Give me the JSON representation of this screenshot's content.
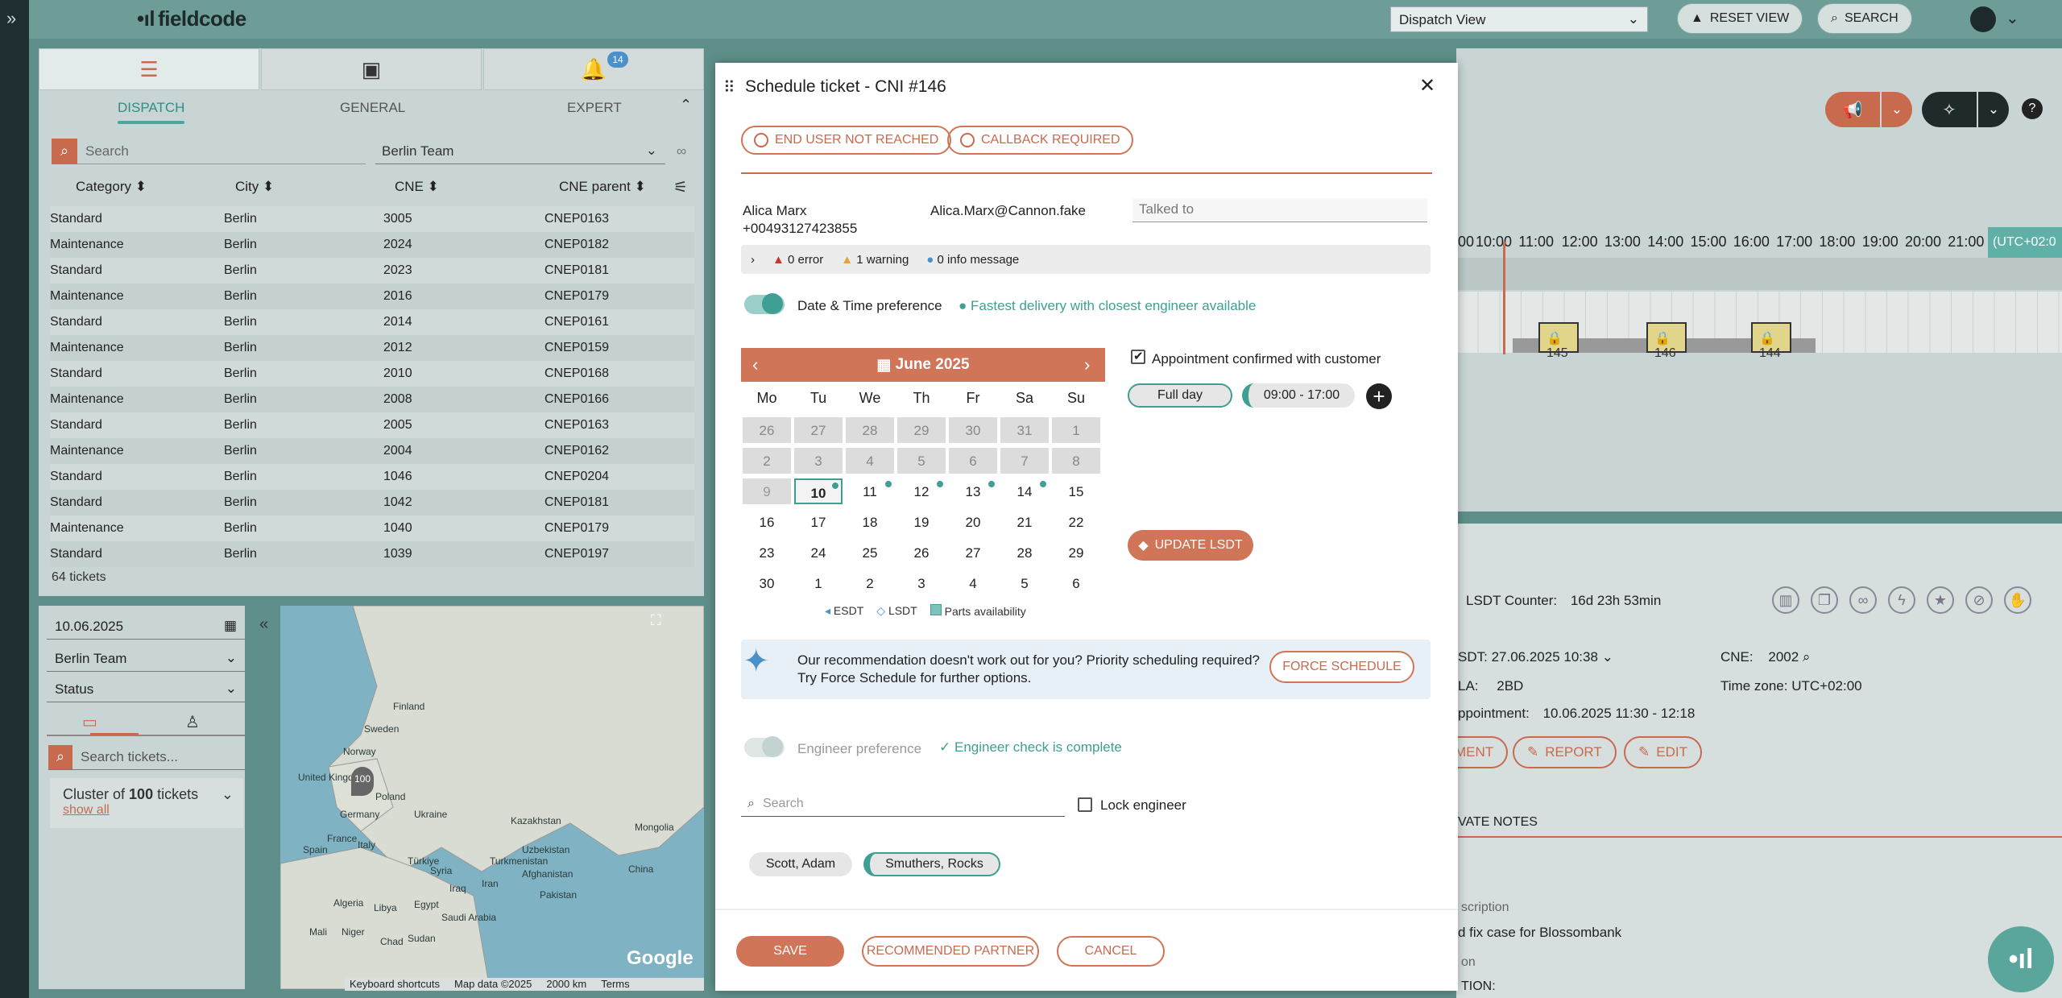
{
  "app": {
    "logo": "fieldcode",
    "view_select": "Dispatch View",
    "reset_view": "RESET VIEW",
    "search": "SEARCH",
    "expand": "»"
  },
  "left": {
    "tabs": [
      {
        "icon": "list-icon"
      },
      {
        "icon": "clipboard-icon"
      },
      {
        "icon": "bell-icon",
        "badge": "14"
      }
    ],
    "subtabs": [
      "DISPATCH",
      "GENERAL",
      "EXPERT"
    ],
    "search_placeholder": "Search",
    "team": "Berlin Team",
    "columns": [
      "Category",
      "City",
      "CNE",
      "CNE parent"
    ],
    "rows": [
      [
        "Standard",
        "Berlin",
        "3005",
        "CNEP0163"
      ],
      [
        "Maintenance",
        "Berlin",
        "2024",
        "CNEP0182"
      ],
      [
        "Standard",
        "Berlin",
        "2023",
        "CNEP0181"
      ],
      [
        "Maintenance",
        "Berlin",
        "2016",
        "CNEP0179"
      ],
      [
        "Standard",
        "Berlin",
        "2014",
        "CNEP0161"
      ],
      [
        "Maintenance",
        "Berlin",
        "2012",
        "CNEP0159"
      ],
      [
        "Standard",
        "Berlin",
        "2010",
        "CNEP0168"
      ],
      [
        "Maintenance",
        "Berlin",
        "2008",
        "CNEP0166"
      ],
      [
        "Standard",
        "Berlin",
        "2005",
        "CNEP0163"
      ],
      [
        "Maintenance",
        "Berlin",
        "2004",
        "CNEP0162"
      ],
      [
        "Standard",
        "Berlin",
        "1046",
        "CNEP0204"
      ],
      [
        "Standard",
        "Berlin",
        "1042",
        "CNEP0181"
      ],
      [
        "Maintenance",
        "Berlin",
        "1040",
        "CNEP0179"
      ],
      [
        "Standard",
        "Berlin",
        "1039",
        "CNEP0197"
      ]
    ],
    "ticket_count": "64 tickets"
  },
  "filter": {
    "date": "10.06.2025",
    "team": "Berlin Team",
    "status": "Status",
    "search_placeholder": "Search tickets...",
    "cluster_prefix": "Cluster of",
    "cluster_count": "100",
    "cluster_suffix": "tickets",
    "show_all": "show all",
    "collapse": "«"
  },
  "map": {
    "labels": [
      "Finland",
      "Sweden",
      "Norway",
      "United Kingdom",
      "Germany",
      "Poland",
      "France",
      "Spain",
      "Italy",
      "Ukraine",
      "Kazakhstan",
      "Mongolia",
      "Türkiye",
      "Uzbekistan",
      "Turkmenistan",
      "Afghanistan",
      "Iran",
      "Iraq",
      "Syria",
      "Pakistan",
      "Algeria",
      "Libya",
      "Egypt",
      "Saudi Arabia",
      "Mali",
      "Niger",
      "Chad",
      "Sudan",
      "China"
    ],
    "marker": "100",
    "footer": [
      "Keyboard shortcuts",
      "Map data ©2025",
      "2000 km",
      "Terms"
    ],
    "brand": "Google"
  },
  "timeline": {
    "hours": [
      "00",
      "10:00",
      "11:00",
      "12:00",
      "13:00",
      "14:00",
      "15:00",
      "16:00",
      "17:00",
      "18:00",
      "19:00",
      "20:00",
      "21:00"
    ],
    "tz": "(UTC+02:0",
    "tickets": [
      "145",
      "146",
      "144"
    ]
  },
  "detail": {
    "lsdt_counter_label": "LSDT Counter:",
    "lsdt_counter": "16d 23h 53min",
    "sdt_label": "SDT:",
    "sdt": "27.06.2025 10:38",
    "cne_label": "CNE:",
    "cne": "2002",
    "sla_label": "LA:",
    "sla": "2BD",
    "tz_label": "Time zone:",
    "tz": "UTC+02:00",
    "appt_label": "ppointment:",
    "appt": "10.06.2025 11:30 - 12:18",
    "btn_ment": "MENT",
    "btn_report": "REPORT",
    "btn_edit": "EDIT",
    "tab_notes": "VATE NOTES",
    "desc_label": "scription",
    "desc": "d fix case for Blossombank",
    "n_label": "on",
    "tion_label": "TION:"
  },
  "modal": {
    "title": "Schedule ticket - CNI #146",
    "status_pills": [
      "END USER NOT REACHED",
      "CALLBACK REQUIRED"
    ],
    "contact_name": "Alica Marx",
    "contact_phone": "+00493127423855",
    "contact_email": "Alica.Marx@Cannon.fake",
    "talked_placeholder": "Talked to",
    "messages": {
      "error": "0 error",
      "warning": "1 warning",
      "info": "0 info message"
    },
    "dt_pref": "Date & Time preference",
    "dt_hint": "Fastest delivery with closest engineer available",
    "calendar": {
      "month": "June 2025",
      "weekdays": [
        "Mo",
        "Tu",
        "We",
        "Th",
        "Fr",
        "Sa",
        "Su"
      ],
      "weeks": [
        [
          "26",
          "27",
          "28",
          "29",
          "30",
          "31",
          "1"
        ],
        [
          "2",
          "3",
          "4",
          "5",
          "6",
          "7",
          "8"
        ],
        [
          "9",
          "10",
          "11",
          "12",
          "13",
          "14",
          "15"
        ],
        [
          "16",
          "17",
          "18",
          "19",
          "20",
          "21",
          "22"
        ],
        [
          "23",
          "24",
          "25",
          "26",
          "27",
          "28",
          "29"
        ],
        [
          "30",
          "1",
          "2",
          "3",
          "4",
          "5",
          "6"
        ]
      ],
      "legend": [
        "ESDT",
        "LSDT",
        "Parts availability"
      ]
    },
    "appt_confirmed": "Appointment confirmed with customer",
    "full_day": "Full day",
    "time_range": "09:00 - 17:00",
    "update_lsdt": "UPDATE LSDT",
    "reco_text1": "Our recommendation doesn't work out for you? Priority scheduling required?",
    "reco_text2": "Try Force Schedule for further options.",
    "force_schedule": "FORCE SCHEDULE",
    "eng_pref": "Engineer preference",
    "eng_check": "Engineer check is complete",
    "eng_search_placeholder": "Search",
    "lock_engineer": "Lock engineer",
    "engineers": [
      "Scott, Adam",
      "Smuthers, Rocks"
    ],
    "save": "SAVE",
    "recommended_partner": "RECOMMENDED PARTNER",
    "cancel": "CANCEL"
  },
  "colors": {
    "accent": "#d07558",
    "teal": "#3f9f94"
  }
}
